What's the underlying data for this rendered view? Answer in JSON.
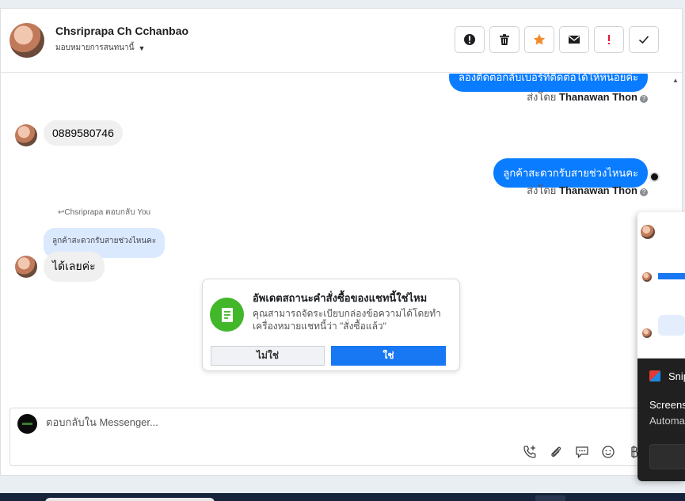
{
  "header": {
    "contact_name": "Chsriprapa Ch Cchanbao",
    "assign_label": "มอบหมายการสนทนานี้",
    "actions": [
      {
        "name": "mark-spam-button",
        "icon": "exclamation-circle-icon"
      },
      {
        "name": "delete-button",
        "icon": "trash-icon"
      },
      {
        "name": "star-button",
        "icon": "star-icon"
      },
      {
        "name": "mark-unread-button",
        "icon": "envelope-icon"
      },
      {
        "name": "follow-up-button",
        "icon": "exclamation-icon"
      },
      {
        "name": "mark-done-button",
        "icon": "checkmark-icon"
      }
    ]
  },
  "messages": {
    "m1_partial": "ลองติดต่อกลับเบอร์ที่ติดต่อได้ให้หน่อยค่ะ",
    "sent_by_prefix": "ส่งโดย",
    "agent_name": "Thanawan Thon",
    "phone": "0889580746",
    "m2": "ลูกค้าสะดวกรับสายช่วงไหนคะ",
    "reply_label": "Chsriprapa ตอบกลับ You",
    "reply_quote": "ลูกค้าสะดวกรับสายช่วงไหนคะ",
    "m3": "ได้เลยค่ะ"
  },
  "dialog": {
    "title": "อัพเดตสถานะคำสั่งซื้อของแชทนี้ใช่ไหม",
    "body": "คุณสามารถจัดระเบียบกล่องข้อความได้โดยทำเครื่องหมายแชทนี้ว่า \"สั่งซื้อแล้ว\"",
    "no_label": "ไม่ใช่",
    "yes_label": "ใช่"
  },
  "composer": {
    "placeholder": "ตอบกลับใน Messenger..."
  },
  "notification": {
    "app_name": "Snip",
    "line1": "Screens",
    "line2": "Automa"
  },
  "colors": {
    "accent": "#0a7cff",
    "primary_button": "#1877f2",
    "dialog_icon": "#42b72a",
    "star": "#f38b2c",
    "follow_up": "#e4173c"
  }
}
